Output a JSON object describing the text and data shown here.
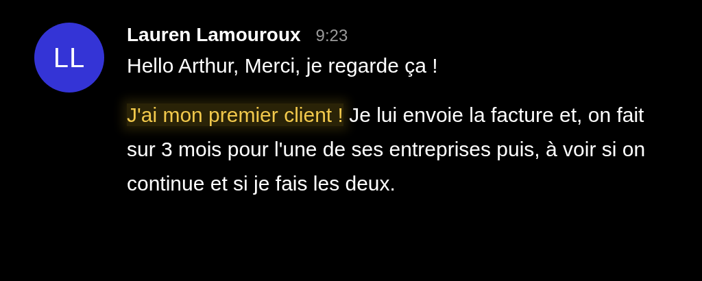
{
  "message": {
    "avatar_initials": "LL",
    "author": "Lauren Lamouroux",
    "time": "9:23",
    "paragraphs": [
      {
        "segments": [
          {
            "text": "Hello Arthur, Merci, je regarde ça !",
            "highlighted": false
          }
        ]
      },
      {
        "segments": [
          {
            "text": "J'ai mon premier client !",
            "highlighted": true
          },
          {
            "text": " Je lui envoie la facture et, on fait sur 3 mois pour l'une de ses entreprises puis, à voir si on continue et si je fais les deux.",
            "highlighted": false
          }
        ]
      }
    ]
  }
}
